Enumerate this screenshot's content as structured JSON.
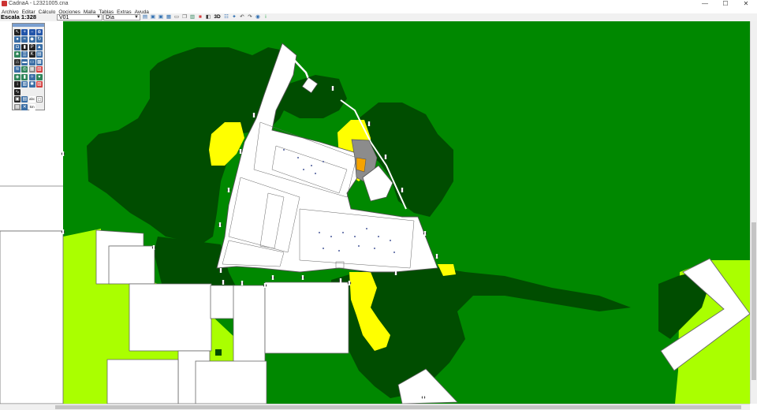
{
  "window": {
    "title": "CadnaA - L2321005.cna",
    "minimize": "—",
    "maximize": "☐",
    "close": "✕"
  },
  "menu": [
    "Archivo",
    "Editar",
    "Cálculo",
    "Opciones",
    "Malla",
    "Tablas",
    "Extras",
    "Ayuda"
  ],
  "toolbar": {
    "scale_label": "Escala 1:328",
    "variant_value": "V01",
    "period_value": "Día",
    "icons": [
      {
        "name": "open-icon",
        "glyph": "▤",
        "color": "#2b6cb0"
      },
      {
        "name": "save-icon",
        "glyph": "▣",
        "color": "#2b6cb0"
      },
      {
        "name": "save-as-icon",
        "glyph": "▣",
        "color": "#2b6cb0"
      },
      {
        "name": "export-icon",
        "glyph": "▦",
        "color": "#2b6cb0"
      },
      {
        "name": "print-icon",
        "glyph": "▭",
        "color": "#555555"
      },
      {
        "name": "copy-icon",
        "glyph": "❐",
        "color": "#555555"
      },
      {
        "name": "calculator-icon",
        "glyph": "▥",
        "color": "#2f855a"
      },
      {
        "name": "grid-color-icon",
        "glyph": "■",
        "color": "#d53f3f"
      },
      {
        "name": "noise-map-icon",
        "glyph": "◧",
        "color": "#333333"
      },
      {
        "name": "3d-view-icon",
        "glyph": "3D",
        "color": "#000000"
      },
      {
        "name": "table-icon",
        "glyph": "☷",
        "color": "#2b6cb0"
      },
      {
        "name": "pin-icon",
        "glyph": "✦",
        "color": "#2b6cb0"
      },
      {
        "name": "undo-icon",
        "glyph": "↶",
        "color": "#444444"
      },
      {
        "name": "redo-icon",
        "glyph": "↷",
        "color": "#444444"
      },
      {
        "name": "eye-icon",
        "glyph": "◉",
        "color": "#2b6cb0"
      },
      {
        "name": "info-icon",
        "glyph": "i",
        "color": "#22aa44"
      }
    ]
  },
  "palette_tools": [
    {
      "name": "select-arrow-icon",
      "glyph": "↖",
      "color": "#222222"
    },
    {
      "name": "zoom-in-icon",
      "glyph": "+",
      "color": "#2255aa"
    },
    {
      "name": "zoom-out-icon",
      "glyph": "−",
      "color": "#2255aa"
    },
    {
      "name": "zoom-extent-icon",
      "glyph": "⊕",
      "color": "#2255aa"
    },
    {
      "name": "point-source-icon",
      "glyph": "●",
      "color": "#3a6ea5"
    },
    {
      "name": "line-source-icon",
      "glyph": "≈",
      "color": "#3a6ea5"
    },
    {
      "name": "area-source-icon",
      "glyph": "◆",
      "color": "#3a6ea5"
    },
    {
      "name": "rotate-icon",
      "glyph": "↻",
      "color": "#3a6ea5"
    },
    {
      "name": "car-road-icon",
      "glyph": "◘",
      "color": "#3a6ea5"
    },
    {
      "name": "train-icon",
      "glyph": "▮",
      "color": "#222222"
    },
    {
      "name": "parking-icon",
      "glyph": "P",
      "color": "#222222"
    },
    {
      "name": "industry-icon",
      "glyph": "▲",
      "color": "#3a6ea5"
    },
    {
      "name": "tree-icon",
      "glyph": "♣",
      "color": "#2f855a"
    },
    {
      "name": "vegetation-icon",
      "glyph": "▒",
      "color": "#3a6ea5"
    },
    {
      "name": "k-icon",
      "glyph": "K",
      "color": "#222222"
    },
    {
      "name": "road-icon",
      "glyph": "▤",
      "color": "#3a6ea5"
    },
    {
      "name": "building-icon",
      "glyph": "⌂",
      "color": "#333333"
    },
    {
      "name": "barrier-icon",
      "glyph": "▬",
      "color": "#3a6ea5"
    },
    {
      "name": "bridge-icon",
      "glyph": "▭",
      "color": "#3a6ea5"
    },
    {
      "name": "terrain-icon",
      "glyph": "▩",
      "color": "#3a6ea5"
    },
    {
      "name": "contour-icon",
      "glyph": "≋",
      "color": "#3a6ea5"
    },
    {
      "name": "receiver-icon",
      "glyph": "◎",
      "color": "#2f855a"
    },
    {
      "name": "receiver-grid-icon",
      "glyph": "▦",
      "color": "#888888"
    },
    {
      "name": "facade-icon",
      "glyph": "▧",
      "color": "#d53f3f"
    },
    {
      "name": "ground-absorption-icon",
      "glyph": "◈",
      "color": "#2f855a"
    },
    {
      "name": "cylinder-icon",
      "glyph": "▮",
      "color": "#2f855a"
    },
    {
      "name": "wind-icon",
      "glyph": "✧",
      "color": "#3a6ea5"
    },
    {
      "name": "polygon-icon",
      "glyph": "▾",
      "color": "#2f855a"
    },
    {
      "name": "dimension-icon",
      "glyph": "↕",
      "color": "#222222"
    },
    {
      "name": "hatch-icon",
      "glyph": "▥",
      "color": "#3a6ea5"
    },
    {
      "name": "symbol-icon",
      "glyph": "✱",
      "color": "#3a6ea5"
    },
    {
      "name": "section-icon",
      "glyph": "▨",
      "color": "#d53f3f"
    },
    {
      "name": "wave-icon",
      "glyph": "∿",
      "color": "#222222"
    },
    {
      "name": "blank-tool-a",
      "glyph": "",
      "color": "#eeeeee"
    },
    {
      "name": "blank-tool-b",
      "glyph": "",
      "color": "#eeeeee"
    },
    {
      "name": "blank-tool-c",
      "glyph": "",
      "color": "#eeeeee"
    },
    {
      "name": "bitmap-icon",
      "glyph": "▣",
      "color": "#222222"
    },
    {
      "name": "image-icon",
      "glyph": "▤",
      "color": "#3a6ea5"
    },
    {
      "name": "text-abc-icon",
      "glyph": "abc",
      "color": "#222222"
    },
    {
      "name": "frame-icon",
      "glyph": "□",
      "color": "#ffffff"
    },
    {
      "name": "grid-icon",
      "glyph": "▦",
      "color": "#888888"
    },
    {
      "name": "measure-icon",
      "glyph": "✕",
      "color": "#3a6ea5"
    },
    {
      "name": "km-icon",
      "glyph": "km",
      "color": "#222222"
    }
  ],
  "map_colors": {
    "zone_high": "#004d00",
    "zone_mid": "#008800",
    "zone_low": "#aaff00",
    "zone_peak": "#ffff00",
    "building": "#ffffff",
    "building_gray": "#8c8c8c",
    "building_orange": "#f5a300"
  }
}
